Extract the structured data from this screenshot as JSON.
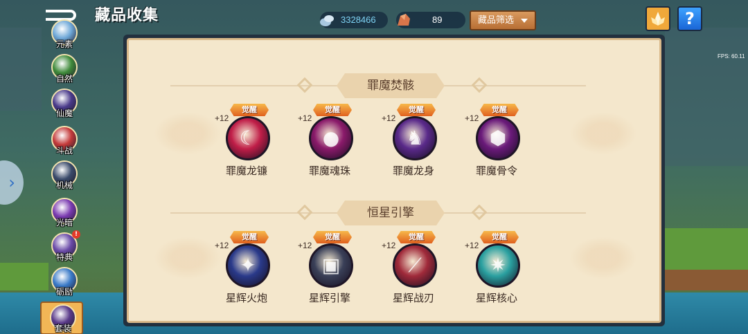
{
  "header": {
    "title": "藏品收集",
    "gem_count": "3328466",
    "ore_count": "89",
    "filter_label": "藏品筛选",
    "help_label": "?",
    "fps": "FPS: 60.11"
  },
  "sidebar": {
    "items": [
      {
        "label": "元素",
        "icon": "element-icon",
        "color": "#6fa8d8"
      },
      {
        "label": "自然",
        "icon": "nature-icon",
        "color": "#3f8a3a"
      },
      {
        "label": "仙魔",
        "icon": "fairy-demon-icon",
        "color": "#4a3a8a"
      },
      {
        "label": "斗战",
        "icon": "battle-icon",
        "color": "#c43a3a"
      },
      {
        "label": "机械",
        "icon": "mech-icon",
        "color": "#3a4a6a"
      },
      {
        "label": "光暗",
        "icon": "light-dark-icon",
        "color": "#7a3ab0"
      },
      {
        "label": "特典",
        "icon": "special-icon",
        "color": "#6a4aa8",
        "badge": "!"
      },
      {
        "label": "砺励",
        "icon": "trial-icon",
        "color": "#3a7ac8"
      },
      {
        "label": "套装",
        "icon": "set-icon",
        "color": "#5a3a8a",
        "active": true
      }
    ]
  },
  "sections": [
    {
      "title": "罪魔焚骸",
      "items": [
        {
          "name": "罪魔龙镰",
          "level": "+12",
          "badge": "觉醒",
          "icon": "scythe-icon",
          "color": "#c01e48"
        },
        {
          "name": "罪魔魂珠",
          "level": "+12",
          "badge": "觉醒",
          "icon": "orb-icon",
          "color": "#8a1a6a"
        },
        {
          "name": "罪魔龙身",
          "level": "+12",
          "badge": "觉醒",
          "icon": "dragon-body-icon",
          "color": "#5a2a8a"
        },
        {
          "name": "罪魔骨令",
          "level": "+12",
          "badge": "觉醒",
          "icon": "bone-token-icon",
          "color": "#6a1a7a"
        }
      ]
    },
    {
      "title": "恒星引擎",
      "items": [
        {
          "name": "星辉火炮",
          "level": "+12",
          "badge": "觉醒",
          "icon": "cannon-icon",
          "color": "#2a3a8a"
        },
        {
          "name": "星辉引擎",
          "level": "+12",
          "badge": "觉醒",
          "icon": "engine-icon",
          "color": "#3a4058"
        },
        {
          "name": "星辉战刃",
          "level": "+12",
          "badge": "觉醒",
          "icon": "blade-icon",
          "color": "#a02a3a"
        },
        {
          "name": "星辉核心",
          "level": "+12",
          "badge": "觉醒",
          "icon": "core-icon",
          "color": "#2aa0a0"
        }
      ]
    }
  ]
}
